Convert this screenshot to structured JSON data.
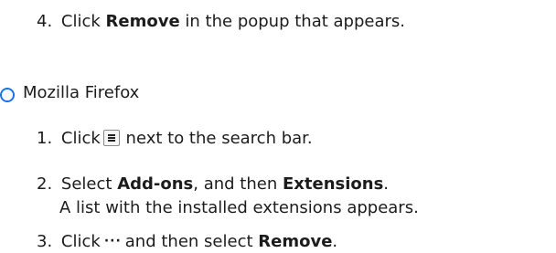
{
  "step4": {
    "num": "4.",
    "prefix": "Click",
    "bold": "Remove",
    "suffix": "in the popup that appears."
  },
  "firefox": {
    "title": "Mozilla Firefox"
  },
  "steps": [
    {
      "num": "1.",
      "prefix": "Click",
      "suffix": "next to the search bar.",
      "icon": "menu-icon"
    },
    {
      "num": "2.",
      "prefix": "Select",
      "bold1": "Add-ons",
      "mid": ", and then",
      "bold2": "Extensions",
      "end": ".",
      "line2": "A list with the installed extensions appears."
    },
    {
      "num": "3.",
      "prefix": "Click",
      "suffix": "and then select",
      "bold": "Remove",
      "end": ".",
      "icon": "ellipsis-icon",
      "dots": "···"
    }
  ],
  "colors": {
    "bullet": "#1a73e8",
    "text": "#1c1c1c"
  }
}
